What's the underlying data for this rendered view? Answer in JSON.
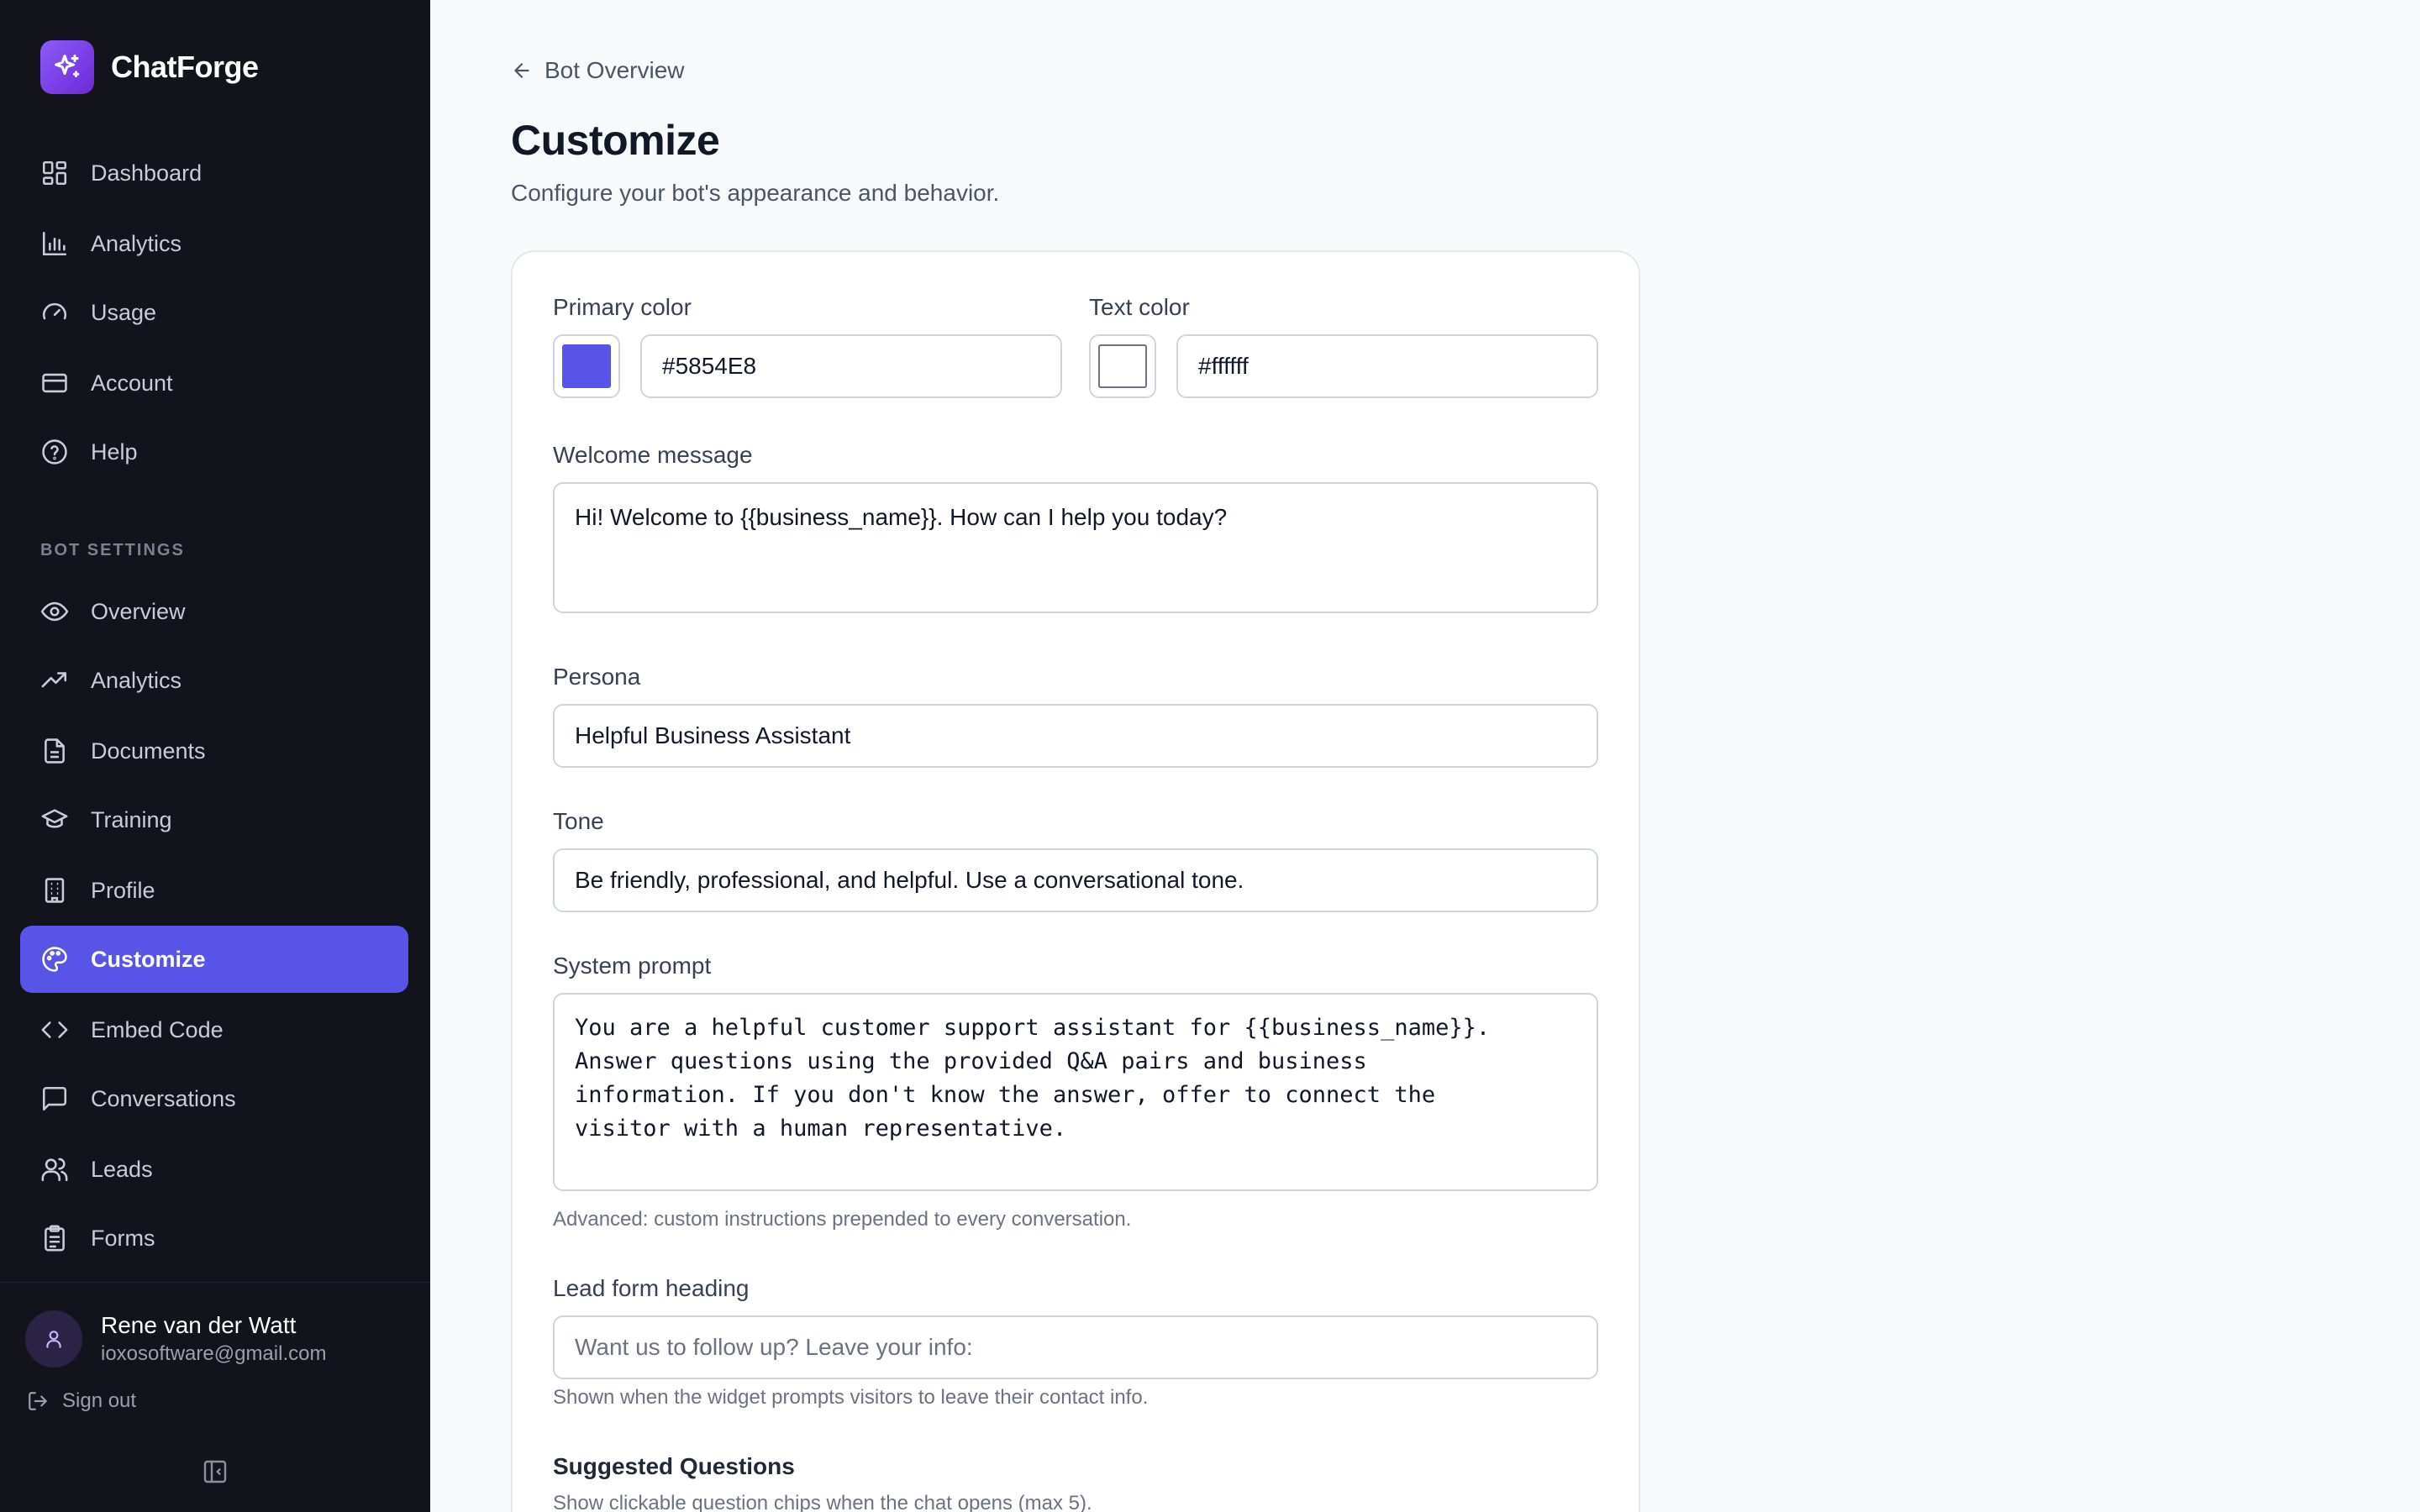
{
  "app": {
    "name": "ChatForge"
  },
  "sidebar": {
    "main_items": [
      {
        "label": "Dashboard",
        "icon": "grid-icon"
      },
      {
        "label": "Analytics",
        "icon": "bar-chart-icon"
      },
      {
        "label": "Usage",
        "icon": "gauge-icon"
      },
      {
        "label": "Account",
        "icon": "credit-card-icon"
      },
      {
        "label": "Help",
        "icon": "help-circle-icon"
      }
    ],
    "section_label": "BOT SETTINGS",
    "bot_items": [
      {
        "label": "Overview",
        "icon": "eye-icon"
      },
      {
        "label": "Analytics",
        "icon": "trending-up-icon"
      },
      {
        "label": "Documents",
        "icon": "document-icon"
      },
      {
        "label": "Training",
        "icon": "graduation-cap-icon"
      },
      {
        "label": "Profile",
        "icon": "building-icon"
      },
      {
        "label": "Customize",
        "icon": "palette-icon",
        "active": true
      },
      {
        "label": "Embed Code",
        "icon": "code-icon"
      },
      {
        "label": "Conversations",
        "icon": "message-square-icon"
      },
      {
        "label": "Leads",
        "icon": "users-icon"
      },
      {
        "label": "Forms",
        "icon": "clipboard-icon"
      }
    ],
    "user": {
      "name": "Rene van der Watt",
      "email": "ioxosoftware@gmail.com"
    },
    "signout_label": "Sign out"
  },
  "header": {
    "back_label": "Bot Overview",
    "title": "Customize",
    "subtitle": "Configure your bot's appearance and behavior."
  },
  "form": {
    "primary_color": {
      "label": "Primary color",
      "value": "#5854E8",
      "swatch": "#5854e8"
    },
    "text_color": {
      "label": "Text color",
      "value": "#ffffff",
      "swatch": "#ffffff"
    },
    "welcome_message": {
      "label": "Welcome message",
      "value": "Hi! Welcome to {{business_name}}. How can I help you today?"
    },
    "persona": {
      "label": "Persona",
      "value": "Helpful Business Assistant"
    },
    "tone": {
      "label": "Tone",
      "value": "Be friendly, professional, and helpful. Use a conversational tone."
    },
    "system_prompt": {
      "label": "System prompt",
      "value": "You are a helpful customer support assistant for {{business_name}}.\nAnswer questions using the provided Q&A pairs and business\ninformation. If you don't know the answer, offer to connect the\nvisitor with a human representative.",
      "hint": "Advanced: custom instructions prepended to every conversation."
    },
    "lead_form_heading": {
      "label": "Lead form heading",
      "placeholder": "Want us to follow up? Leave your info:",
      "hint": "Shown when the widget prompts visitors to leave their contact info."
    },
    "suggested_questions": {
      "label": "Suggested Questions",
      "hint": "Show clickable question chips when the chat opens (max 5)."
    }
  },
  "colors": {
    "accent": "#5854e8",
    "sidebar_bg": "#13131c",
    "page_bg": "#f8f9fb"
  }
}
